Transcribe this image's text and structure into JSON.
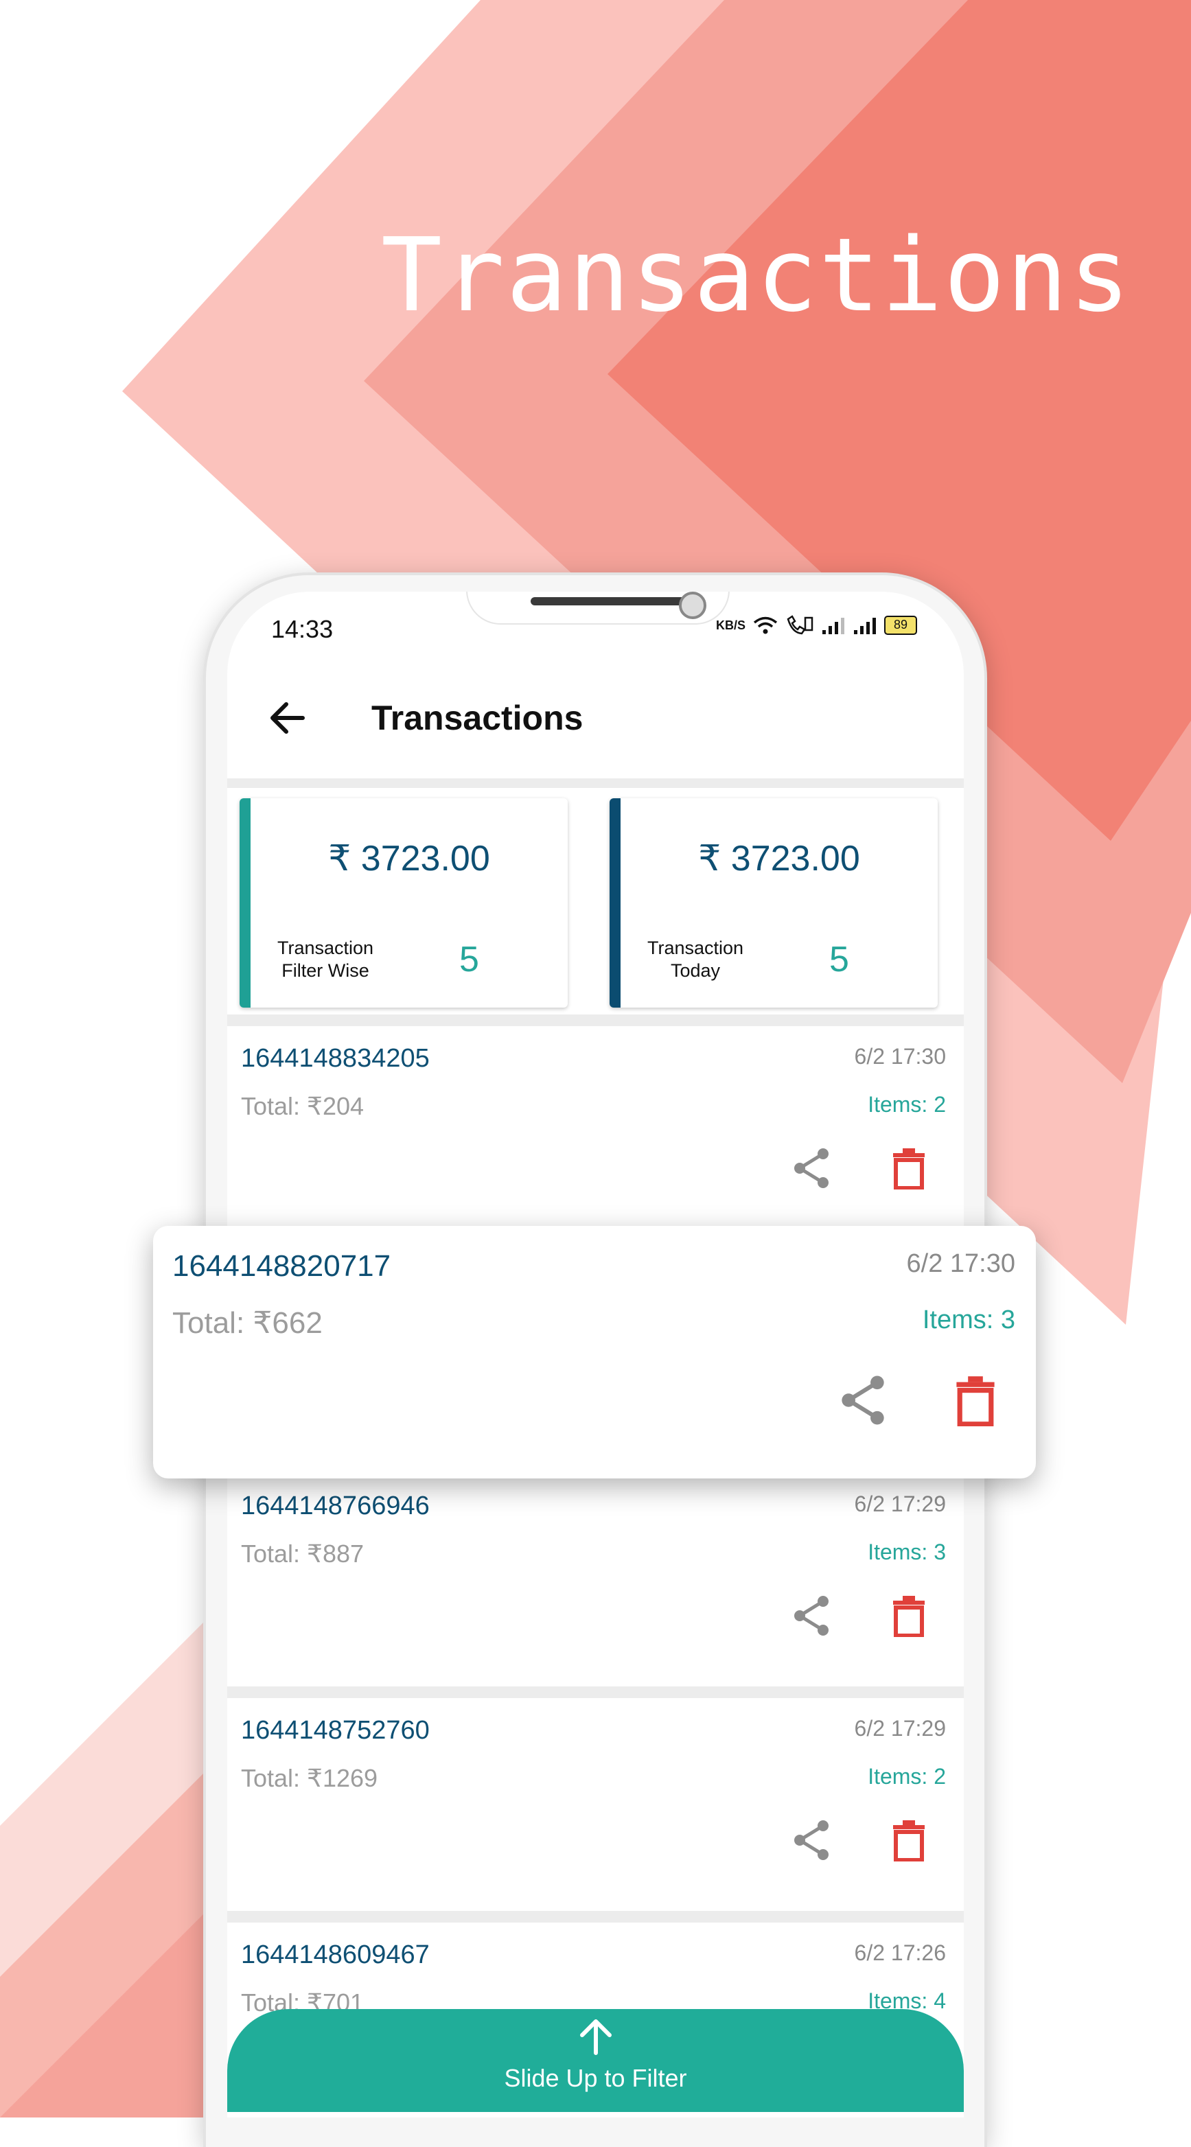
{
  "hero_title": "Transactions",
  "colors": {
    "accent_teal": "#20ad99",
    "id_blue": "#0e4f73",
    "delete_red": "#e0403a",
    "background_salmon": "#f28275"
  },
  "status_bar": {
    "time": "14:33",
    "net_speed": "KB/S",
    "battery": "89",
    "icons": [
      "wifi-icon",
      "volte-call-icon",
      "signal-icon",
      "signal-icon",
      "battery-icon"
    ]
  },
  "app_bar": {
    "back_icon": "arrow-left-icon",
    "title": "Transactions"
  },
  "summary": [
    {
      "amount": "₹ 3723.00",
      "label": "Transaction Filter Wise",
      "count": "5",
      "bar_color": "#1fa095"
    },
    {
      "amount": "₹ 3723.00",
      "label": "Transaction Today",
      "count": "5",
      "bar_color": "#0b4c70"
    }
  ],
  "transactions": [
    {
      "id": "1644148834205",
      "date": "6/2 17:30",
      "total": "Total: ₹204",
      "items": "Items: 2"
    },
    {
      "id": "1644148820717",
      "date": "6/2 17:30",
      "total": "Total: ₹662",
      "items": "Items: 3"
    },
    {
      "id": "1644148766946",
      "date": "6/2 17:29",
      "total": "Total: ₹887",
      "items": "Items: 3"
    },
    {
      "id": "1644148752760",
      "date": "6/2 17:29",
      "total": "Total: ₹1269",
      "items": "Items: 2"
    },
    {
      "id": "1644148609467",
      "date": "6/2 17:26",
      "total": "Total: ₹701",
      "items": "Items: 4"
    }
  ],
  "slide_up": {
    "icon": "arrow-up-icon",
    "label": "Slide Up to Filter"
  }
}
